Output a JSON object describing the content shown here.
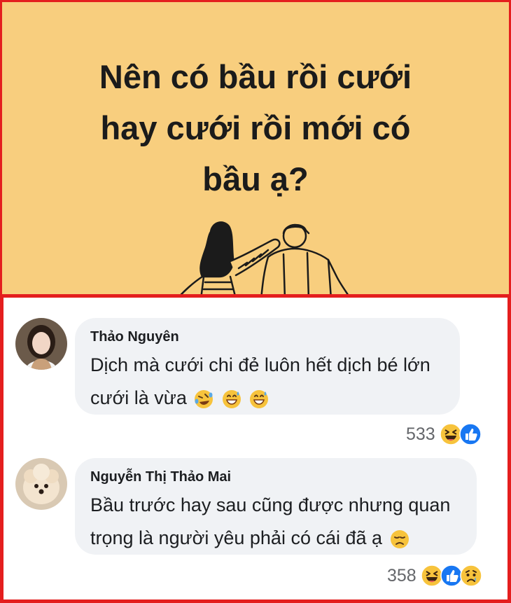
{
  "poster": {
    "title_lines": [
      "Nên có bầu rồi cưới",
      "hay cưới rồi mới có",
      "bầu ạ?"
    ],
    "background_color": "#f8ce7e"
  },
  "comments": [
    {
      "author": "Thảo Nguyên",
      "text_lines": [
        "Dịch mà cưới chi đẻ luôn hết dịch bé lớn",
        "cưới là vừa"
      ],
      "inline_emojis": [
        "rolling-laughing-emoji",
        "grinning-sweat-emoji",
        "grinning-sweat-emoji"
      ],
      "reaction_count": "533",
      "reactions": [
        "haha-reaction-icon",
        "like-reaction-icon"
      ]
    },
    {
      "author": "Nguyễn Thị Thảo Mai",
      "text_lines": [
        "Bầu trước hay sau cũng được nhưng quan",
        "trọng là người yêu phải có cái đã ạ"
      ],
      "inline_emojis": [
        "disappointed-face-emoji"
      ],
      "reaction_count": "358",
      "reactions": [
        "haha-reaction-icon",
        "like-reaction-icon",
        "sad-reaction-icon"
      ]
    }
  ],
  "colors": {
    "highlight_border": "#e41e1e",
    "bubble": "#f0f2f5",
    "like_blue": "#1877f2",
    "emoji_yellow": "#f7c33c"
  }
}
